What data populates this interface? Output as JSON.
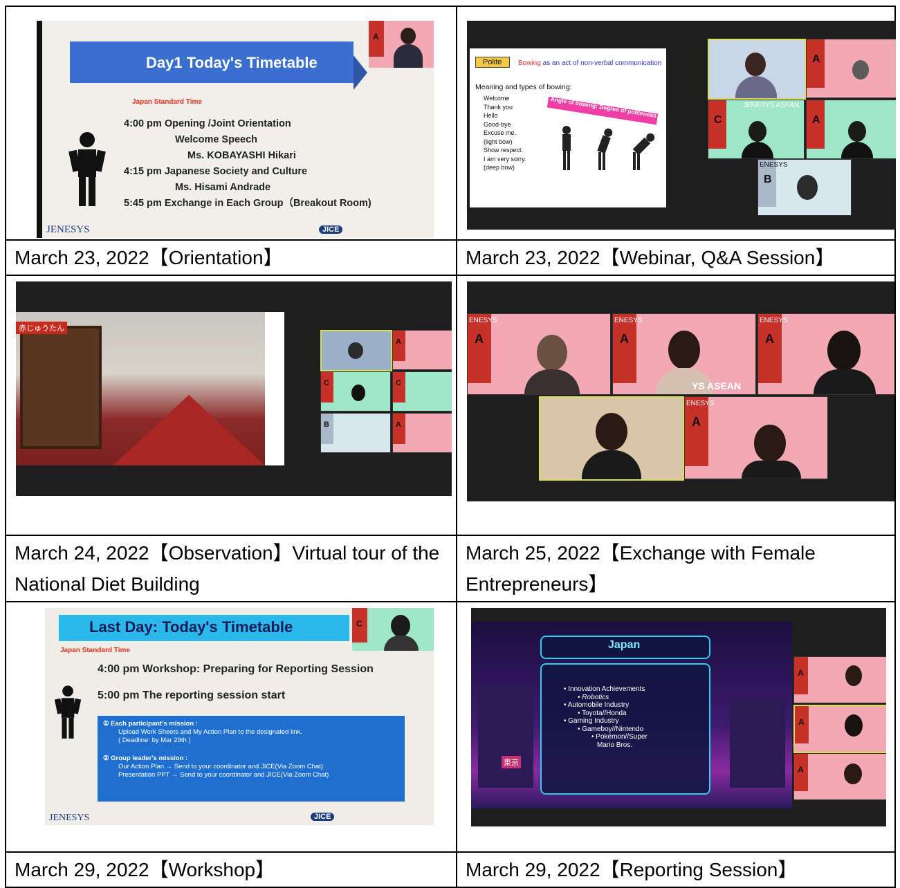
{
  "rows": [
    {
      "left": {
        "caption": "March 23, 2022【Orientation】"
      },
      "right": {
        "caption": "March 23, 2022【Webinar, Q&A Session】"
      }
    },
    {
      "left": {
        "caption_line1": "March 24, 2022【Observation】Virtual tour of the",
        "caption_line2": "National Diet Building"
      },
      "right": {
        "caption_line1": "March 25, 2022【Exchange with Female",
        "caption_line2": "Entrepreneurs】"
      }
    },
    {
      "left": {
        "caption": "March 29, 2022【Workshop】"
      },
      "right": {
        "caption": "March 29, 2022【Reporting Session】"
      }
    }
  ],
  "slide1": {
    "title": "Day1 Today's Timetable",
    "tz": "Japan Standard Time",
    "lines": [
      "4:00 pm  Opening /Joint Orientation",
      "Welcome Speech",
      "Ms. KOBAYASHI Hikari",
      "4:15 pm  Japanese Society and Culture",
      "Ms. Hisami  Andrade",
      "5:45 pm  Exchange in Each Group（Breakout Room)"
    ],
    "logo": "JENESYS",
    "jice": "JICE",
    "badge": "A"
  },
  "slide2": {
    "polite": "Polite",
    "heading_red": "Bowing",
    "heading_rest": " as an act of non-verbal communication",
    "meaning": "Meaning and types of bowing:",
    "items": [
      "Welcome",
      "Thank you",
      "Hello",
      "Good-bye",
      "Excuse me.",
      "(light bow)",
      "Show respect.",
      "I am very sorry.",
      "(deep bow)"
    ],
    "arrow": "Angle of bowing: Degree of politeness",
    "badges": [
      "A",
      "C",
      "A",
      "B"
    ],
    "brand": "ENESYS",
    "asean": "JENESYS ASEAN"
  },
  "slide3": {
    "jp_label": "赤じゅうたん",
    "badges": [
      "A",
      "C",
      "C",
      "B",
      "A"
    ]
  },
  "slide4": {
    "brand": "ENESYS",
    "badges": [
      "A",
      "A",
      "A",
      "A"
    ],
    "asean": "YS ASEAN"
  },
  "slide5": {
    "title": "Last Day: Today's Timetable",
    "tz": "Japan Standard Time",
    "l1": "4:00 pm  Workshop: Preparing for Reporting Session",
    "l2": "5:00 pm   The reporting session start",
    "m1_title": "①   Each participant's mission :",
    "m1_b1": "Upload Work Sheets and My Action Plan to the designated link.",
    "m1_b2": "( Deadline: by Mar 29th )",
    "m2_title": "②   Group leader's mission :",
    "m2_b1": "Our Action Plan   → Send to your coordinator and JICE(Via Zoom Chat)",
    "m2_b2": "Presentation PPT  → Send to your coordinator and JICE(Via Zoom Chat)",
    "logo": "JENESYS",
    "jice": "JICE",
    "badge": "C"
  },
  "slide6": {
    "title": "Japan",
    "items": [
      {
        "lvl": 1,
        "t": "Innovation Achievements"
      },
      {
        "lvl": 2,
        "t": "Robotics"
      },
      {
        "lvl": 1,
        "t": "Automobile Industry"
      },
      {
        "lvl": 2,
        "t": "Toyota//Honda"
      },
      {
        "lvl": 1,
        "t": "Gaming Industry"
      },
      {
        "lvl": 2,
        "t": "Gameboy//Nintendo"
      },
      {
        "lvl": 3,
        "t": "Pokémon//Super"
      },
      {
        "lvl": 3,
        "t": "Mario Bros."
      }
    ],
    "sign": "東京",
    "badges": [
      "A",
      "A",
      "A"
    ]
  },
  "colors": {
    "slide_blue": "#3a6fd0",
    "cyan": "#2ad0f0",
    "zoom_bg": "#1e1e1e",
    "pink": "#f2a9b3",
    "navy_bg": "#1a0f3e"
  }
}
